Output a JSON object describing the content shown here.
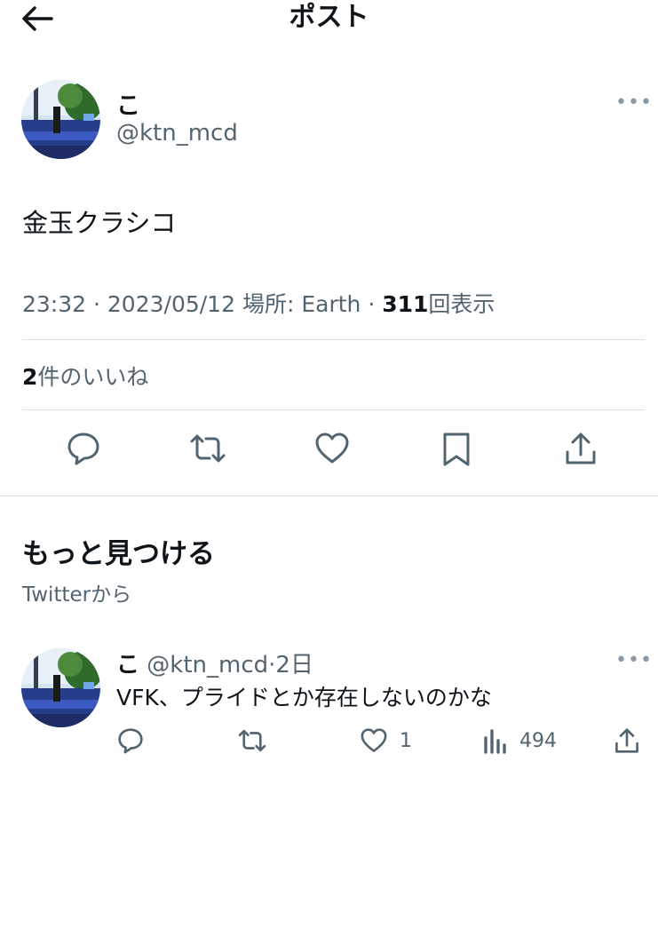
{
  "header": {
    "title": "ポスト"
  },
  "post": {
    "author_name": "こ",
    "author_handle": "@ktn_mcd",
    "more_label": "•••",
    "text": "金玉クラシコ",
    "time": "23:32",
    "date": "2023/05/12",
    "location": "場所: Earth",
    "separator": "·",
    "views_count": "311",
    "views_label": "回表示",
    "likes_count": "2",
    "likes_label": "件のいいね"
  },
  "discover": {
    "title": "もっと見つける",
    "subtitle": "Twitterから"
  },
  "reply": {
    "author_name": "こ",
    "author_handle": "@ktn_mcd",
    "separator": "·",
    "age": "2日",
    "more_label": "•••",
    "text": "VFK、プライドとか存在しないのかな",
    "like_count": "1",
    "views_count": "494"
  },
  "colors": {
    "text": "#0f1419",
    "secondary": "#536471",
    "divider": "#dfe3e6"
  },
  "icons": [
    "back-arrow-icon",
    "reply-icon",
    "retweet-icon",
    "like-icon",
    "bookmark-icon",
    "share-icon",
    "views-icon"
  ]
}
